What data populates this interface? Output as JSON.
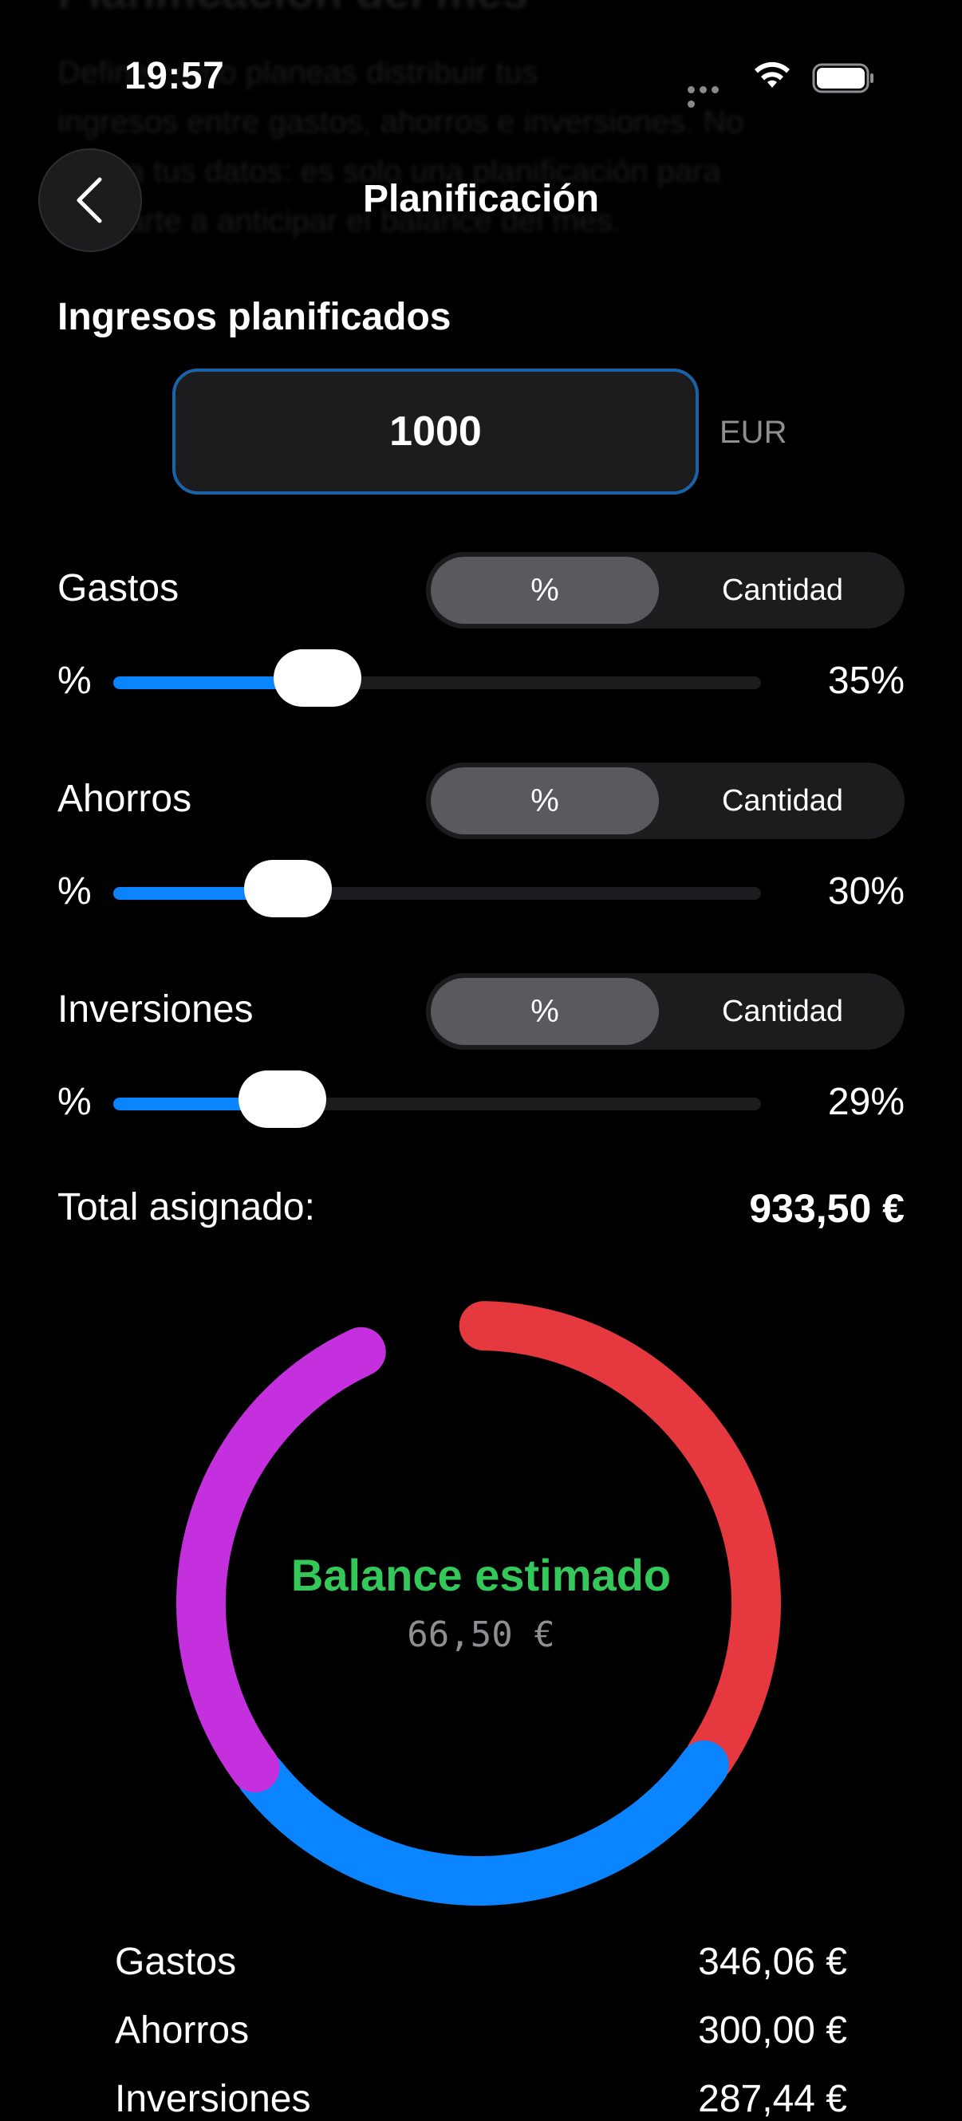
{
  "status": {
    "time": "19:57"
  },
  "header": {
    "title": "Planificación"
  },
  "background_text": {
    "title": "Planificación del mes",
    "lines": [
      "Define cómo planeas distribuir tus",
      "ingresos entre gastos, ahorros e inversiones. No",
      "afecta tus datos: es solo una planificación para",
      "ayudarte a anticipar el balance del mes."
    ]
  },
  "income": {
    "label": "Ingresos planificados",
    "value": "1000",
    "currency": "EUR"
  },
  "categories": [
    {
      "label": "Gastos",
      "seg_pct": "%",
      "seg_amount": "Cantidad",
      "symbol": "%",
      "percent": 35,
      "value_text": "35%"
    },
    {
      "label": "Ahorros",
      "seg_pct": "%",
      "seg_amount": "Cantidad",
      "symbol": "%",
      "percent": 30,
      "value_text": "30%"
    },
    {
      "label": "Inversiones",
      "seg_pct": "%",
      "seg_amount": "Cantidad",
      "symbol": "%",
      "percent": 29,
      "value_text": "29%"
    }
  ],
  "total": {
    "label": "Total asignado:",
    "value": "933,50 €"
  },
  "balance": {
    "title": "Balance estimado",
    "value": "66,50 €"
  },
  "chart_data": {
    "type": "pie",
    "categories": [
      "Gastos",
      "Ahorros",
      "Inversiones",
      "Balance"
    ],
    "values": [
      346.06,
      300.0,
      287.44,
      66.5
    ],
    "colors": [
      "#e5393f",
      "#0a84ff",
      "#c42fde",
      "#000000"
    ]
  },
  "legend": [
    {
      "label": "Gastos",
      "value": "346,06 €"
    },
    {
      "label": "Ahorros",
      "value": "300,00 €"
    },
    {
      "label": "Inversiones",
      "value": "287,44 €"
    }
  ],
  "colors": {
    "accent": "#0a84ff",
    "positive": "#34c759",
    "gastos": "#e5393f",
    "ahorros": "#0a84ff",
    "inversiones": "#c42fde"
  }
}
